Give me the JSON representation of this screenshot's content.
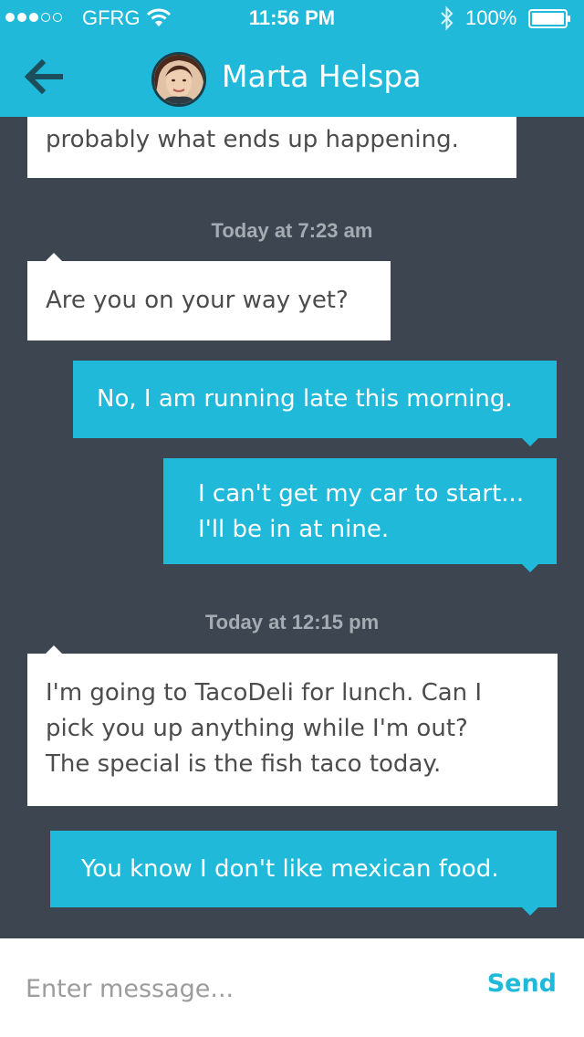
{
  "status_bar": {
    "carrier": "GFRG",
    "time": "11:56 PM",
    "battery": "100%",
    "signal_bars": 3,
    "signal_max": 5
  },
  "header": {
    "contact_name": "Marta Helspa",
    "back_icon": "arrow-left-icon"
  },
  "messages": [
    {
      "direction": "in",
      "lines": [
        "probably what ends up happening."
      ]
    },
    {
      "timestamp": "Today at 7:23 am"
    },
    {
      "direction": "in",
      "lines": [
        "Are you on your way yet?"
      ]
    },
    {
      "direction": "out",
      "lines": [
        "No, I am running late this morning."
      ]
    },
    {
      "direction": "out",
      "lines": [
        "I can't get my car to start...",
        "I'll be in at nine."
      ]
    },
    {
      "timestamp": "Today at 12:15 pm"
    },
    {
      "direction": "in",
      "lines": [
        "I'm going to TacoDeli for lunch.  Can I",
        "pick you up anything while I'm out?",
        "The special is the fish taco today."
      ]
    },
    {
      "direction": "out",
      "lines": [
        "You know I don't like mexican food."
      ]
    }
  ],
  "composer": {
    "placeholder": "Enter message...",
    "value": "",
    "send_label": "Send"
  },
  "colors": {
    "accent": "#21b9d9",
    "background": "#3d4650",
    "bubble_in": "#ffffff",
    "text_dark": "#4c4c4c",
    "timestamp": "#a4abb2"
  }
}
